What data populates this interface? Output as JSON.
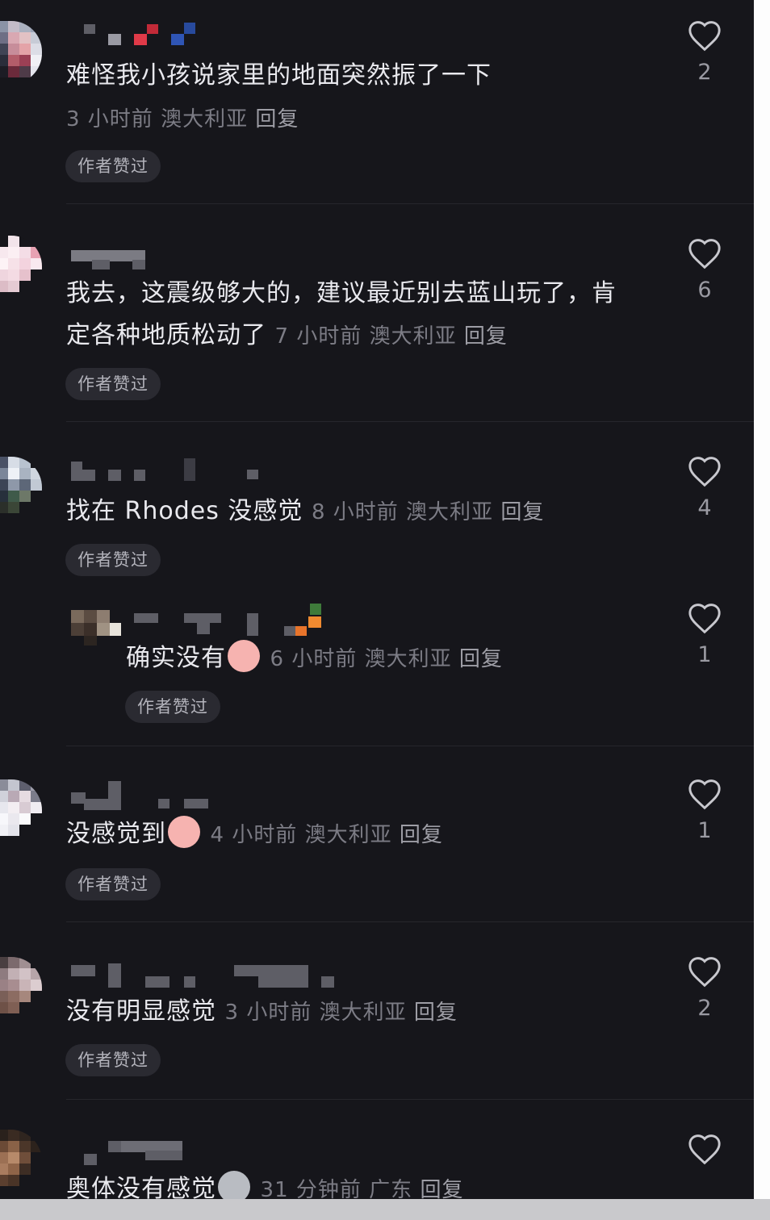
{
  "comments": [
    {
      "text": "难怪我小孩说家里的地面突然振了一下",
      "time": "3 小时前",
      "location": "澳大利亚",
      "reply_label": "回复",
      "badge": "作者赞过",
      "likes": "2"
    },
    {
      "text": "我去，这震级够大的，建议最近别去蓝山玩了，肯定各种地质松动了",
      "time": "7 小时前",
      "location": "澳大利亚",
      "reply_label": "回复",
      "badge": "作者赞过",
      "likes": "6"
    },
    {
      "text": "找在 Rhodes 没感觉",
      "time": "8 小时前",
      "location": "澳大利亚",
      "reply_label": "回复",
      "badge": "作者赞过",
      "likes": "4"
    },
    {
      "text": "确实没有",
      "emoji": "sleepy-face-emoji",
      "time": "6 小时前",
      "location": "澳大利亚",
      "reply_label": "回复",
      "badge": "作者赞过",
      "likes": "1"
    },
    {
      "text": "没感觉到",
      "emoji": "crying-face-emoji",
      "time": "4 小时前",
      "location": "澳大利亚",
      "reply_label": "回复",
      "badge": "作者赞过",
      "likes": "1"
    },
    {
      "text": "没有明显感觉",
      "time": "3 小时前",
      "location": "澳大利亚",
      "reply_label": "回复",
      "badge": "作者赞过",
      "likes": "2"
    },
    {
      "text": "奥体没有感觉",
      "emoji": "shocked-face-emoji",
      "time": "31 分钟前",
      "location": "广东",
      "reply_label": "回复",
      "likes": ""
    }
  ],
  "colors": {
    "background": "#16161b",
    "text": "#e9e9ee",
    "meta": "#7c7c85",
    "badge_bg": "#2a2a31"
  }
}
